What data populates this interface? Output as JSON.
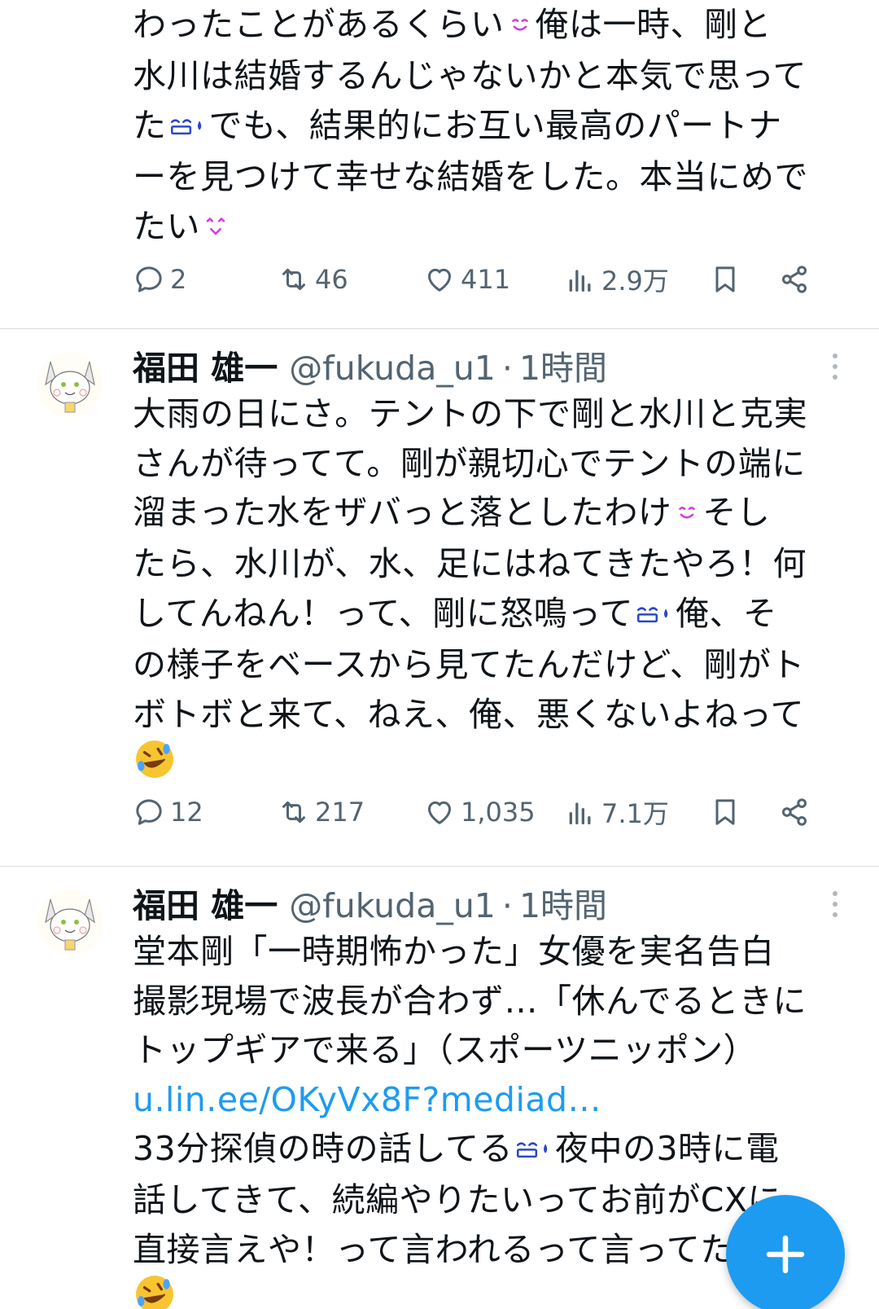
{
  "tweets": [
    {
      "lines": [
        [
          "わったことがあるくらい",
          "smile",
          "俺は一時、剛と"
        ],
        [
          "水川は結婚するんじゃないかと本気で思って"
        ],
        [
          "た",
          "sweat",
          "でも、結果的にお互い最高のパートナ"
        ],
        [
          "ーを見つけて幸せな結婚をした。本当にめで"
        ],
        [
          "たい",
          "heart-smile"
        ]
      ],
      "stats": {
        "reply": "2",
        "retweet": "46",
        "like": "411",
        "views": "2.9万"
      }
    },
    {
      "name": "福田 雄一",
      "handle": "@fukuda_u1",
      "separator": "·",
      "time": "1時間",
      "lines": [
        [
          "大雨の日にさ。テントの下で剛と水川と克実"
        ],
        [
          "さんが待ってて。剛が親切心でテントの端に"
        ],
        [
          "溜まった水をザバっと落としたわけ",
          "smile",
          "そし"
        ],
        [
          "たら、水川が、水、足にはねてきたやろ！何"
        ],
        [
          "してんねん！って、剛に怒鳴って",
          "sweat",
          "俺、そ"
        ],
        [
          "の様子をベースから見てたんだけど、剛がト"
        ],
        [
          "ボトボと来て、ねえ、俺、悪くないよねって"
        ],
        [
          "",
          "rofl"
        ]
      ],
      "stats": {
        "reply": "12",
        "retweet": "217",
        "like": "1,035",
        "views": "7.1万"
      }
    },
    {
      "name": "福田 雄一",
      "handle": "@fukuda_u1",
      "separator": "·",
      "time": "1時間",
      "lines": [
        [
          "堂本剛「一時期怖かった」女優を実名告白"
        ],
        [
          "撮影現場で波長が合わず…「休んでるときに"
        ],
        [
          "トップギアで来る」（スポーツニッポン）"
        ],
        [
          "u.lin.ee/OKyVx8F?mediad…"
        ],
        [
          "33分探偵の時の話してる",
          "sweat",
          "夜中の3時に電"
        ],
        [
          "話してきて、続編やりたいってお前がCXに"
        ],
        [
          "直接言えや！って言われるって言ってた"
        ],
        [
          "",
          "rofl"
        ]
      ],
      "link_line": 3
    }
  ],
  "icons": {
    "reply": "reply-icon",
    "retweet": "retweet-icon",
    "like": "like-icon",
    "views": "views-icon",
    "bookmark": "bookmark-icon",
    "share": "share-icon",
    "more": "more-icon",
    "compose": "compose-plus-icon"
  },
  "colors": {
    "accent": "#1d9bf0",
    "text": "#0f1419",
    "muted": "#536471",
    "divider": "#d7dde2"
  }
}
